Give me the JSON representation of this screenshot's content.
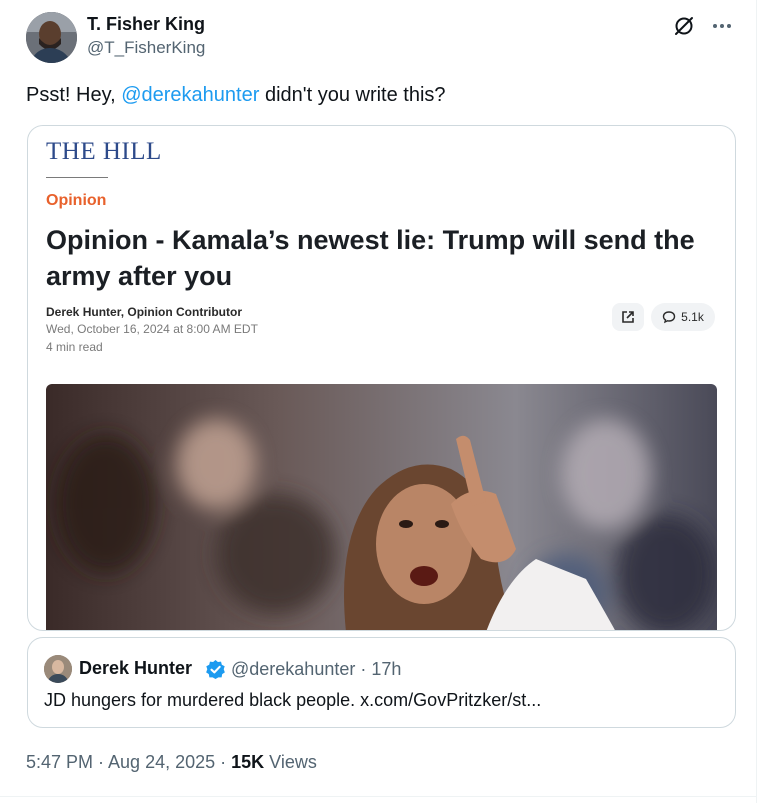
{
  "author": {
    "name": "T. Fisher King",
    "handle": "@T_FisherKing"
  },
  "tweet": {
    "text_before": "Psst! Hey, ",
    "mention": "@derekahunter",
    "text_after": " didn't you write this?"
  },
  "article": {
    "publication": "THE HILL",
    "section": "Opinion",
    "headline": "Opinion - Kamala’s newest lie: Trump will send the army after you",
    "byline": "Derek Hunter, Opinion Contributor",
    "date": "Wed, October 16, 2024 at 8:00 AM EDT",
    "read_time": "4 min read",
    "comment_count": "5.1k"
  },
  "quote": {
    "name": "Derek Hunter",
    "handle_time": "@derekahunter · 17h",
    "text": "JD hungers for murdered black people. x.com/GovPritzker/st..."
  },
  "meta": {
    "time_date": "5:47 PM · Aug 24, 2025 · ",
    "views_count": "15K",
    "views_label": " Views"
  },
  "icons": {
    "grok": "grok-icon",
    "more": "more-icon",
    "share": "external-link-icon",
    "comments": "comment-bubble-icon",
    "verified": "verified-badge-icon"
  },
  "colors": {
    "link": "#1d9bf0",
    "verified": "#1d9bf0",
    "hill_blue": "#2d4a8a",
    "opinion_orange": "#e8612c"
  }
}
